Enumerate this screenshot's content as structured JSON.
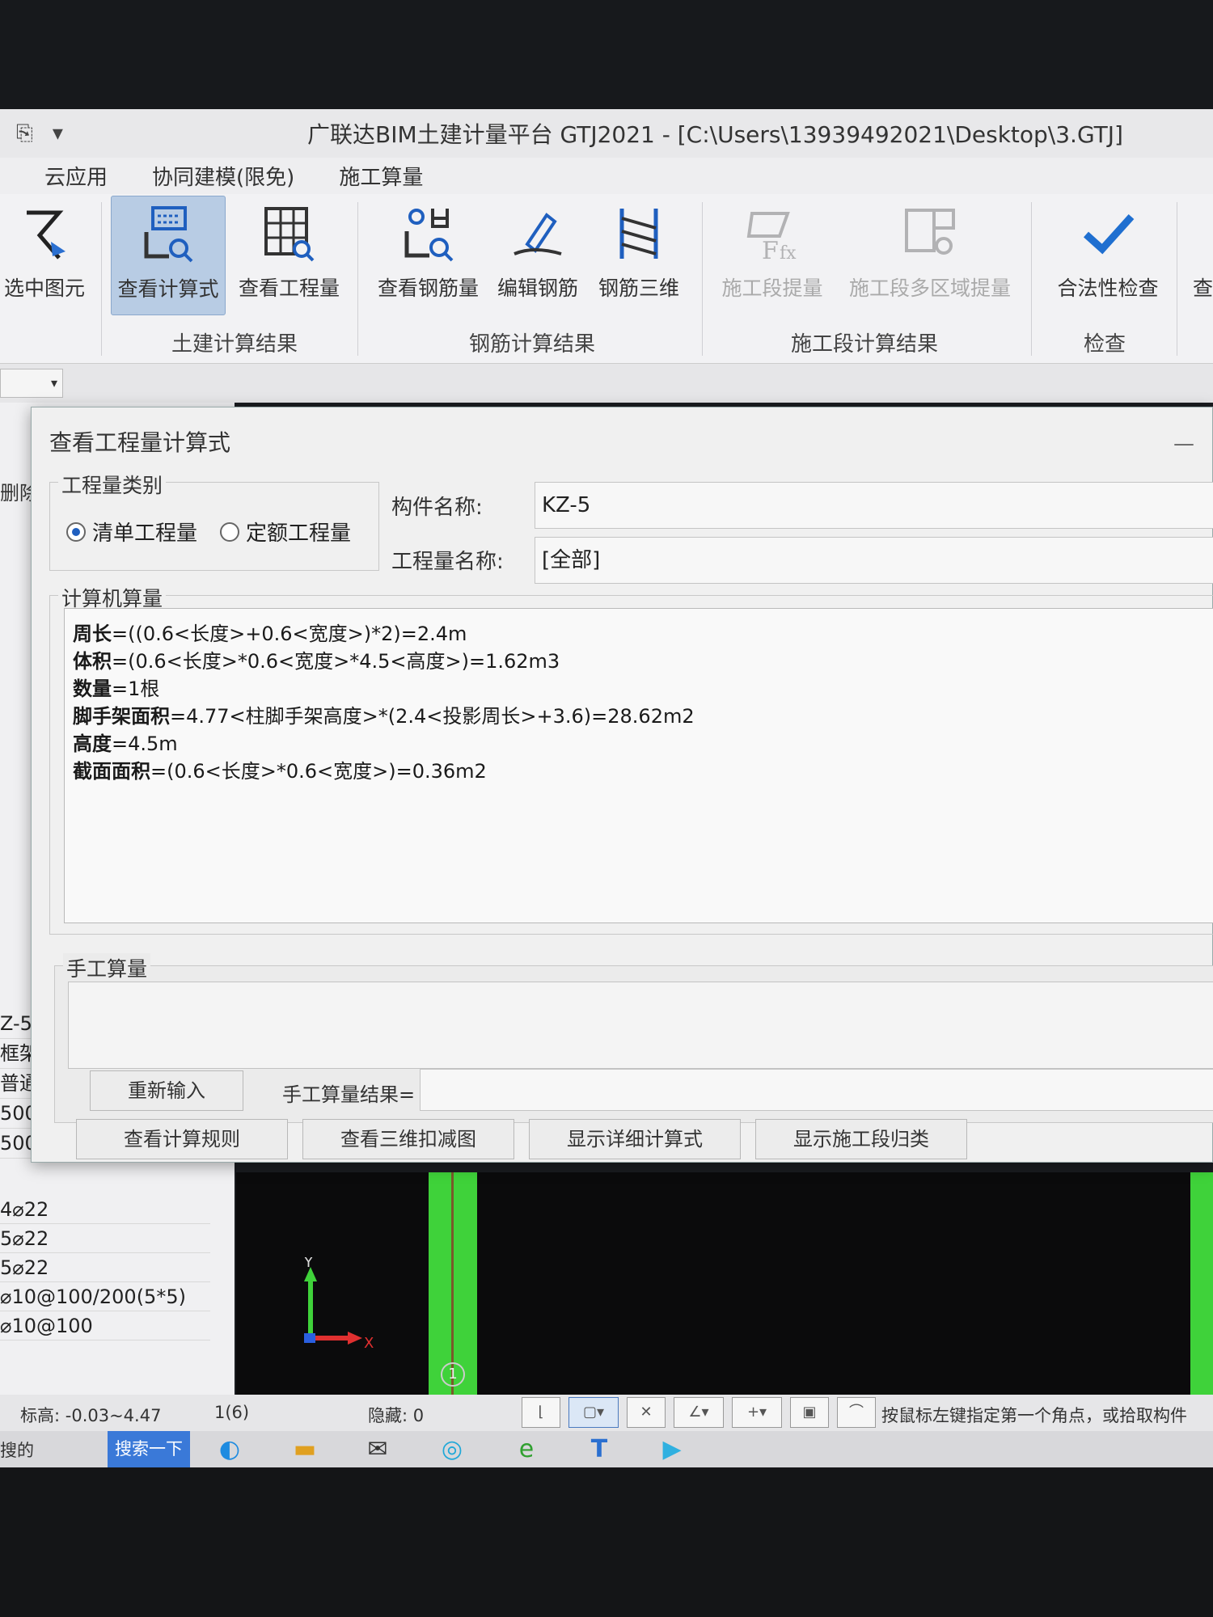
{
  "window": {
    "title": "广联达BIM土建计量平台 GTJ2021 - [C:\\Users\\13939492021\\Desktop\\3.GTJ]"
  },
  "menu": [
    "云应用",
    "协同建模(限免)",
    "施工算量"
  ],
  "ribbon": {
    "select_element": "选中图元",
    "view_formula": "查看计算式",
    "view_quantity": "查看工程量",
    "group_civil": "土建计算结果",
    "view_rebar_qty": "查看钢筋量",
    "edit_rebar": "编辑钢筋",
    "rebar_3d": "钢筋三维",
    "group_rebar": "钢筋计算结果",
    "stage_qty": "施工段提量",
    "stage_multi": "施工段多区域提量",
    "group_stage": "施工段计算结果",
    "validity_check": "合法性检查",
    "group_check": "检查",
    "cut_label": "查"
  },
  "left_panel": {
    "delete": "删除",
    "rows": [
      "Z-5",
      "框架柱",
      "普通柱",
      "500",
      "500"
    ],
    "rebar_rows": [
      "4⌀22",
      "5⌀22",
      "5⌀22",
      "⌀10@100/200(5*5)",
      "⌀10@100"
    ]
  },
  "dialog": {
    "title": "查看工程量计算式",
    "category_legend": "工程量类别",
    "radio_bill": "清单工程量",
    "radio_quota": "定额工程量",
    "component_label": "构件名称:",
    "component_value": "KZ-5",
    "qty_name_label": "工程量名称:",
    "qty_name_value": "[全部]",
    "computer_legend": "计算机算量",
    "lines": [
      {
        "name": "周长",
        "formula": "=((0.6<长度>+0.6<宽度>)*2)=2.4m"
      },
      {
        "name": "体积",
        "formula": "=(0.6<长度>*0.6<宽度>*4.5<高度>)=1.62m3"
      },
      {
        "name": "数量",
        "formula": "=1根"
      },
      {
        "name": "脚手架面积",
        "formula": "=4.77<柱脚手架高度>*(2.4<投影周长>+3.6)=28.62m2"
      },
      {
        "name": "高度",
        "formula": "=4.5m"
      },
      {
        "name": "截面面积",
        "formula": "=(0.6<长度>*0.6<宽度>)=0.36m2"
      }
    ],
    "manual_legend": "手工算量",
    "reinput_btn": "重新输入",
    "manual_result_label": "手工算量结果=",
    "btn_rules": "查看计算规则",
    "btn_3d": "查看三维扣减图",
    "btn_detail": "显示详细计算式",
    "btn_stage": "显示施工段归类"
  },
  "viewport": {
    "axis_y": "Y",
    "axis_x": "X",
    "axis_number": "1"
  },
  "status": {
    "elevation": "标高:  -0.03~4.47",
    "count": "1(6)",
    "hidden": "隐藏:  0",
    "hint": "按鼠标左键指定第一个角点，或拾取构件"
  },
  "taskbar": {
    "search_text": "搜的",
    "search_btn": "搜索一下"
  }
}
